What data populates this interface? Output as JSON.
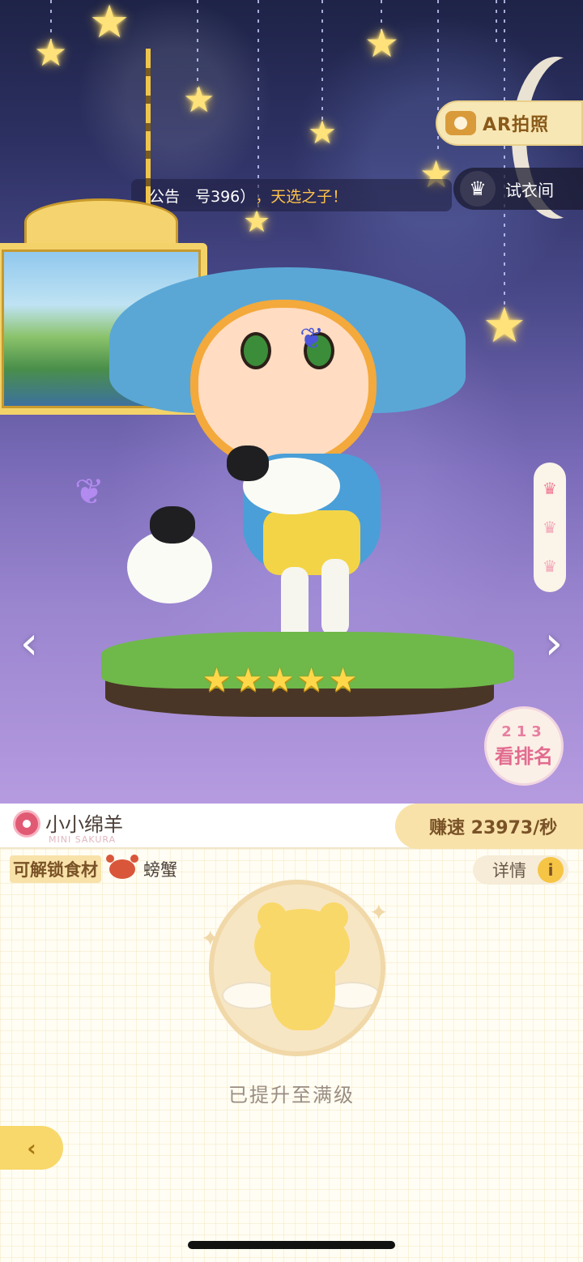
{
  "top": {
    "ar_button": "AR拍照",
    "notice": {
      "prefix": "公告　号396）",
      "highlight": "，天选之子！"
    },
    "wardrobe": "试衣间",
    "stars": [
      "★",
      "★",
      "★",
      "★",
      "★"
    ],
    "rank": {
      "numbers": "213",
      "label": "看排名"
    },
    "level_icons": [
      "crown-icon",
      "crown-icon",
      "crown-icon"
    ]
  },
  "panel": {
    "name": "小小绵羊",
    "subtitle": "MINI SAKURA",
    "speed": "赚速 23973/秒",
    "unlock_title": "可解锁食材",
    "ingredient": "螃蟹",
    "detail": "详情",
    "info_glyph": "i",
    "max_level": "已提升至满级"
  },
  "colors": {
    "accent_gold": "#f8e2a9",
    "sky_top": "#1e2347",
    "sky_bottom": "#b69be0",
    "pink": "#e26b8f"
  }
}
